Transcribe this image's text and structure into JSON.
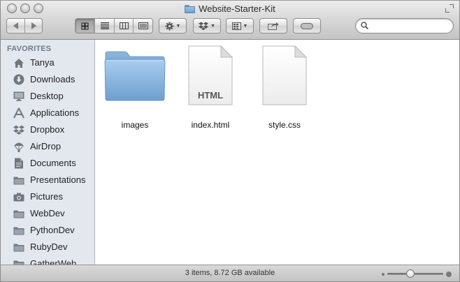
{
  "window": {
    "title": "Website-Starter-Kit"
  },
  "toolbar": {
    "nav": [
      "back-arrow",
      "forward-arrow"
    ],
    "view_modes": [
      "icon-view",
      "list-view",
      "column-view",
      "cover-flow-view"
    ],
    "active_view": "icon-view",
    "action_icon": "gear-icon",
    "dropbox_icon": "dropbox-icon",
    "arrange_icon": "arrange-grid-icon",
    "share_icon": "share-icon",
    "tags_icon": "tag-pill-icon"
  },
  "search": {
    "value": "",
    "placeholder": ""
  },
  "sidebar": {
    "heading": "FAVORITES",
    "items": [
      {
        "label": "Tanya",
        "icon": "home-icon"
      },
      {
        "label": "Downloads",
        "icon": "downloads-icon"
      },
      {
        "label": "Desktop",
        "icon": "desktop-icon"
      },
      {
        "label": "Applications",
        "icon": "applications-icon"
      },
      {
        "label": "Dropbox",
        "icon": "dropbox-icon"
      },
      {
        "label": "AirDrop",
        "icon": "airdrop-icon"
      },
      {
        "label": "Documents",
        "icon": "documents-icon"
      },
      {
        "label": "Presentations",
        "icon": "folder-icon"
      },
      {
        "label": "Pictures",
        "icon": "camera-icon"
      },
      {
        "label": "WebDev",
        "icon": "folder-icon"
      },
      {
        "label": "PythonDev",
        "icon": "folder-icon"
      },
      {
        "label": "RubyDev",
        "icon": "folder-icon"
      },
      {
        "label": "GatherWeb",
        "icon": "folder-icon"
      }
    ]
  },
  "files": [
    {
      "name": "images",
      "icon": "folder-icon"
    },
    {
      "name": "index.html",
      "icon": "html-file-icon",
      "badge": "HTML"
    },
    {
      "name": "style.css",
      "icon": "document-icon"
    }
  ],
  "statusbar": {
    "text": "3 items, 8.72 GB available",
    "zoom_level": 0.4
  },
  "colors": {
    "sidebar_bg": "#e3e8ef",
    "folder_blue": "#8ab7e0",
    "toolbar_gradient_top": "#ececec"
  }
}
